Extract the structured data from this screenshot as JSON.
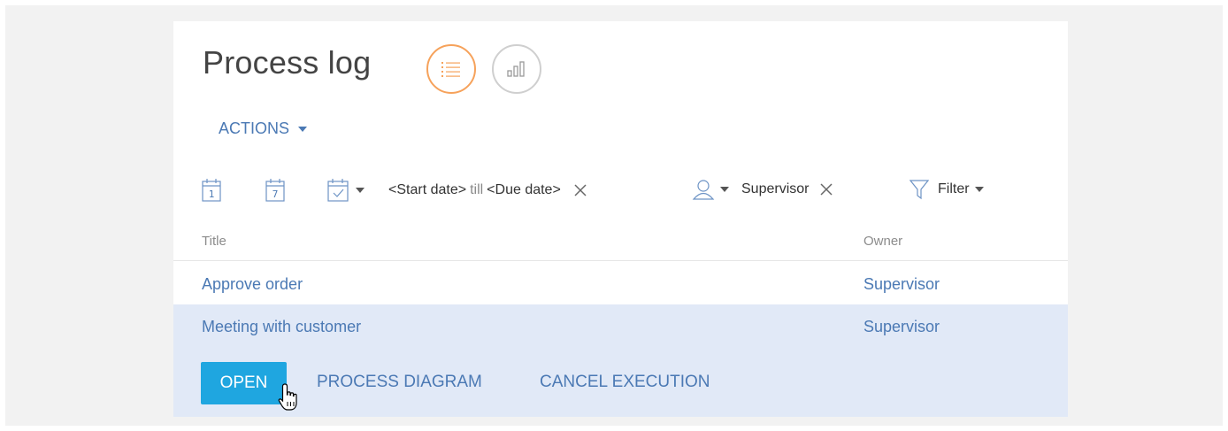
{
  "header": {
    "title": "Process log"
  },
  "view_buttons": [
    {
      "icon": "list-view-icon",
      "active": true
    },
    {
      "icon": "bar-chart-icon",
      "active": false
    }
  ],
  "toolbar": {
    "actions_label": "ACTIONS"
  },
  "filters": {
    "calendar_day_number": "1",
    "calendar_week_number": "7",
    "start_date": "<Start date>",
    "till": "till",
    "due_date": "<Due date>",
    "owner": "Supervisor",
    "filter_label": "Filter"
  },
  "table": {
    "columns": [
      "Title",
      "Owner"
    ],
    "rows": [
      {
        "title": "Approve order",
        "owner": "Supervisor"
      },
      {
        "title": "Meeting with customer",
        "owner": "Supervisor"
      }
    ]
  },
  "row_actions": {
    "open_label": "OPEN",
    "diagram_label": "PROCESS DIAGRAM",
    "cancel_label": "CANCEL EXECUTION"
  },
  "colors": {
    "accent_link": "#4b79b4",
    "open_button": "#1fa6e0",
    "active_view_border": "#f6a25b",
    "selected_row": "#e1e9f7"
  }
}
